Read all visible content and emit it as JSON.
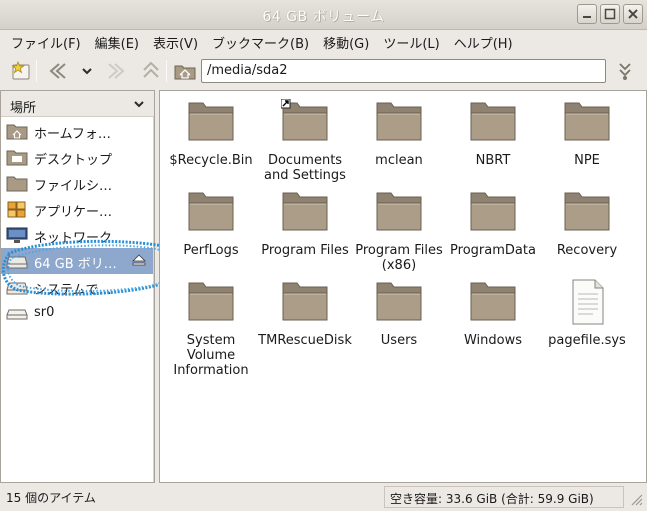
{
  "window": {
    "title": "64 GB ボリューム",
    "controls": {
      "minimize": "minimize-icon",
      "maximize": "maximize-icon",
      "close": "close-icon"
    }
  },
  "menu": [
    "ファイル(F)",
    "編集(E)",
    "表示(V)",
    "ブックマーク(B)",
    "移動(G)",
    "ツール(L)",
    "ヘルプ(H)"
  ],
  "toolbar": {
    "location": "/media/sda2",
    "icons": [
      "bookmark-star-icon",
      "back-icon",
      "history-dropdown-icon",
      "forward-icon",
      "up-icon",
      "home-folder-icon",
      "toggle-path-icon"
    ]
  },
  "sidebar": {
    "header": "場所",
    "items": [
      {
        "label": "ホームフォ…",
        "icon": "home-folder-icon"
      },
      {
        "label": "デスクトップ",
        "icon": "desktop-folder-icon"
      },
      {
        "label": "ファイルシ…",
        "icon": "filesystem-icon"
      },
      {
        "label": "アプリケー…",
        "icon": "applications-icon"
      },
      {
        "label": "ネットワーク",
        "icon": "network-icon"
      },
      {
        "label": "64 GB ボリ…",
        "icon": "drive-icon",
        "selected": true
      },
      {
        "label": "システムで…",
        "icon": "drive-icon"
      },
      {
        "label": "sr0",
        "icon": "optical-drive-icon"
      }
    ]
  },
  "files": [
    {
      "name": "$Recycle.Bin",
      "type": "folder"
    },
    {
      "name": "Documents and Settings",
      "type": "folder-link"
    },
    {
      "name": "mclean",
      "type": "folder"
    },
    {
      "name": "NBRT",
      "type": "folder"
    },
    {
      "name": "NPE",
      "type": "folder"
    },
    {
      "name": "PerfLogs",
      "type": "folder"
    },
    {
      "name": "Program Files",
      "type": "folder"
    },
    {
      "name": "Program Files (x86)",
      "type": "folder"
    },
    {
      "name": "ProgramData",
      "type": "folder"
    },
    {
      "name": "Recovery",
      "type": "folder"
    },
    {
      "name": "System Volume Information",
      "type": "folder"
    },
    {
      "name": "TMRescueDisk",
      "type": "folder"
    },
    {
      "name": "Users",
      "type": "folder"
    },
    {
      "name": "Windows",
      "type": "folder"
    },
    {
      "name": "pagefile.sys",
      "type": "file"
    }
  ],
  "status": {
    "item_count": "15 個のアイテム",
    "free_space": "空き容量: 33.6 GiB (合計: 59.9 GiB)"
  },
  "colors": {
    "selection": "#8da7cd",
    "folder": "#a89a85",
    "marker": "#2a8fd6"
  }
}
